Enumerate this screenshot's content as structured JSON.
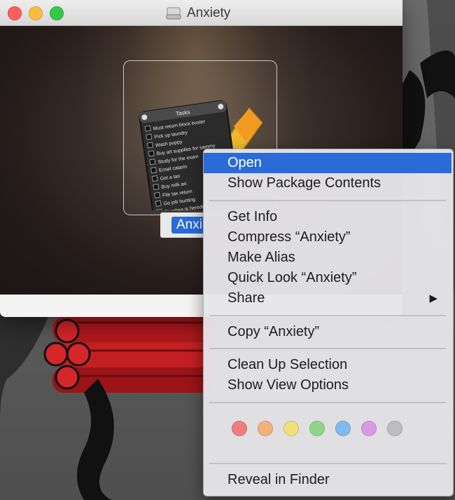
{
  "window": {
    "title": "Anxiety",
    "rename_text": "Anxie"
  },
  "tasks_widget": {
    "header": "Tasks",
    "items": [
      "Must return block buster",
      "Pick up laundry",
      "Wash puppy",
      "Buy art supplies for sammy",
      "Study for the exam",
      "Email catarin",
      "Get a tan",
      "Buy milk an",
      "File tax return",
      "Go job hunting",
      "Diarrhea is hereditary"
    ]
  },
  "context_menu": {
    "groups": [
      [
        "Open",
        "Show Package Contents"
      ],
      [
        "Get Info",
        "Compress “Anxiety”",
        "Make Alias",
        "Quick Look “Anxiety”",
        "Share"
      ],
      [
        "Copy “Anxiety”"
      ],
      [
        "Clean Up Selection",
        "Show View Options"
      ],
      [
        "Reveal in Finder"
      ]
    ],
    "highlighted": "Open",
    "submenu_arrow": "▶",
    "tag_colors": [
      "#f07e7e",
      "#f2b27a",
      "#f1df7a",
      "#8fd68c",
      "#7fbbf0",
      "#d79be6",
      "#bdbdbd"
    ],
    "tag_names": [
      "red",
      "orange",
      "yellow",
      "green",
      "blue",
      "purple",
      "gray"
    ]
  },
  "icons": {
    "window_icon": "drive-icon",
    "app_icon": "tasks-app-icon"
  }
}
